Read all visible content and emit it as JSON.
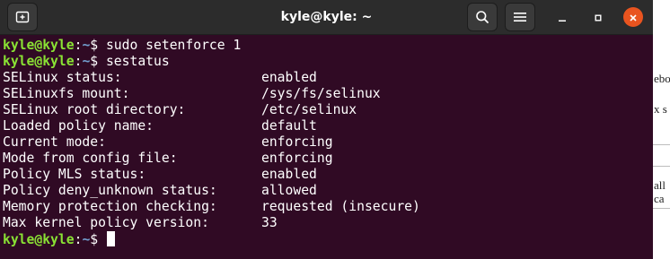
{
  "window": {
    "title": "kyle@kyle: ~"
  },
  "titlebar": {
    "new_tab_icon": "new-tab-icon",
    "search_icon": "search-icon",
    "menu_icon": "hamburger-menu-icon",
    "minimize_icon": "minimize-icon",
    "maximize_icon": "maximize-icon",
    "close_icon": "close-icon",
    "close_color": "#e9541f"
  },
  "colors": {
    "terminal_bg": "#300a24",
    "prompt_user": "#8ae234",
    "prompt_path": "#729fcf",
    "text": "#ffffff"
  },
  "terminal": {
    "prompt": {
      "user_host": "kyle@kyle",
      "colon": ":",
      "path": "~",
      "symbol": "$"
    },
    "commands": [
      {
        "text": " sudo setenforce 1"
      },
      {
        "text": " sestatus"
      }
    ],
    "output": [
      {
        "key": "SELinux status:",
        "value": "enabled"
      },
      {
        "key": "SELinuxfs mount:",
        "value": "/sys/fs/selinux"
      },
      {
        "key": "SELinux root directory:",
        "value": "/etc/selinux"
      },
      {
        "key": "Loaded policy name:",
        "value": "default"
      },
      {
        "key": "Current mode:",
        "value": "enforcing"
      },
      {
        "key": "Mode from config file:",
        "value": "enforcing"
      },
      {
        "key": "Policy MLS status:",
        "value": "enabled"
      },
      {
        "key": "Policy deny_unknown status:",
        "value": "allowed"
      },
      {
        "key": "Memory protection checking:",
        "value": "requested (insecure)"
      },
      {
        "key": "Max kernel policy version:",
        "value": "33"
      }
    ],
    "final_prompt_trailing": " "
  },
  "background_document": {
    "fragments": [
      "ebo",
      "x s",
      "all",
      "ca"
    ]
  }
}
